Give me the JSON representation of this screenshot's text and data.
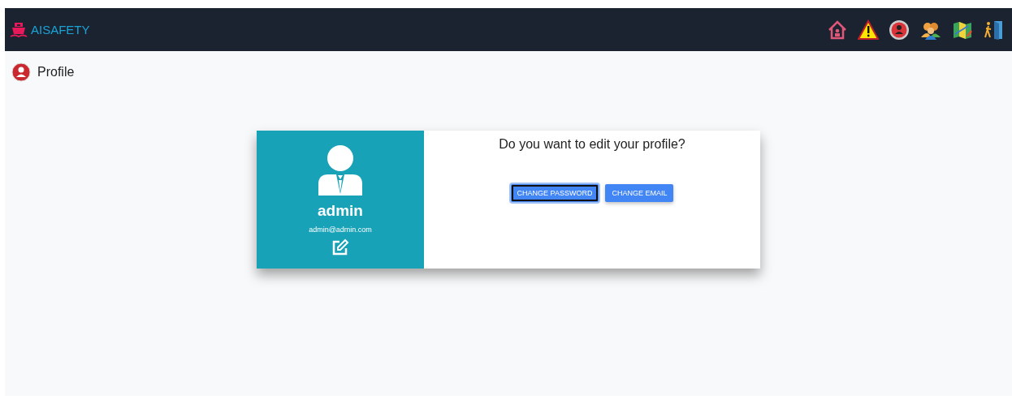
{
  "header": {
    "brand": "AISAFETY",
    "nav": [
      {
        "kind": "home"
      },
      {
        "kind": "warning"
      },
      {
        "kind": "profile"
      },
      {
        "kind": "users"
      },
      {
        "kind": "map"
      },
      {
        "kind": "exit"
      }
    ]
  },
  "page_title": "Profile",
  "profile": {
    "name": "admin",
    "email": "admin@admin.com"
  },
  "prompt": "Do you want to edit your profile?",
  "buttons": [
    {
      "label": "CHANGE PASSWORD",
      "focused": true
    },
    {
      "label": "CHANGE EMAIL",
      "focused": false
    }
  ]
}
